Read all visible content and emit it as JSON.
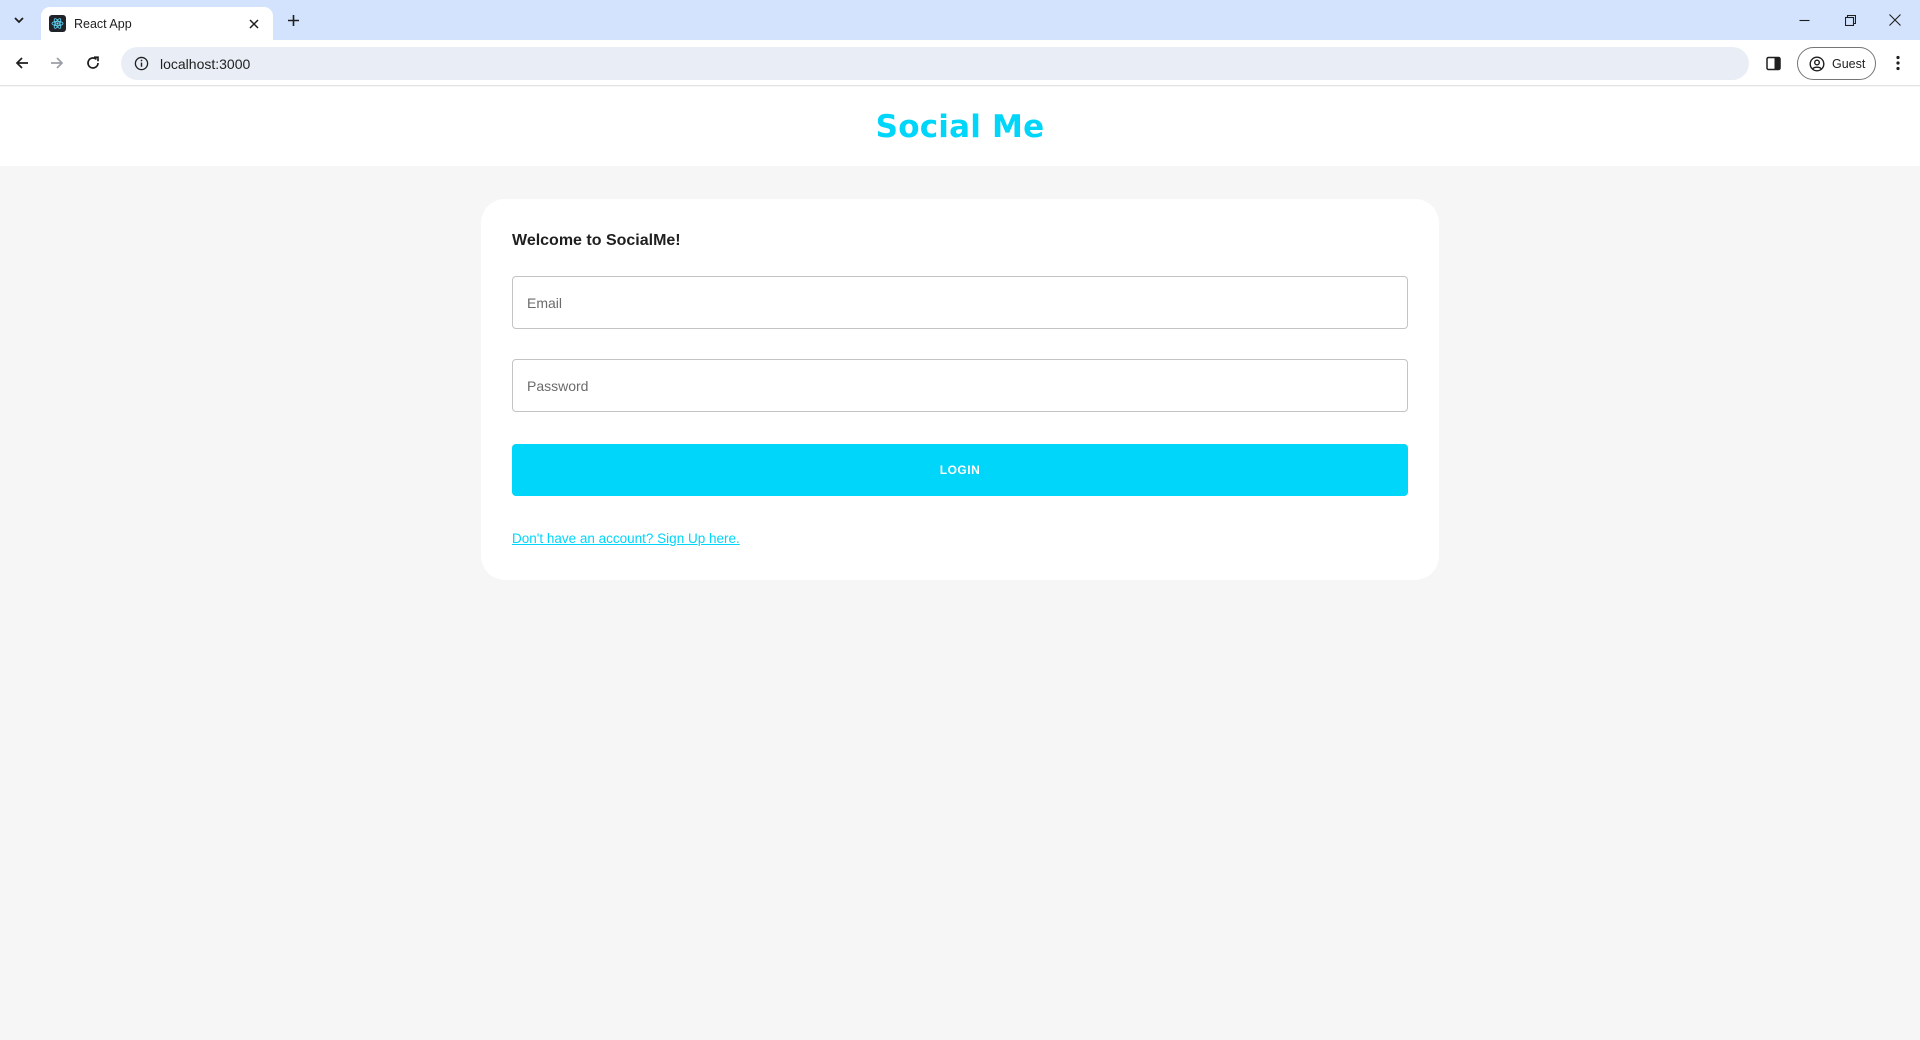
{
  "browser": {
    "tab": {
      "title": "React App",
      "favicon": "react-icon"
    },
    "address_bar": {
      "url": "localhost:3000"
    },
    "profile": {
      "label": "Guest"
    }
  },
  "app": {
    "title": "Social Me"
  },
  "login_form": {
    "heading": "Welcome to SocialMe!",
    "email": {
      "value": "",
      "placeholder": "Email"
    },
    "password": {
      "value": "",
      "placeholder": "Password"
    },
    "submit_label": "LOGIN",
    "signup_link": "Don't have an account? Sign Up here."
  },
  "colors": {
    "accent": "#00d5fa",
    "page_background": "#f6f6f6",
    "card_background": "#ffffff",
    "tabstrip_background": "#d3e3fd"
  }
}
